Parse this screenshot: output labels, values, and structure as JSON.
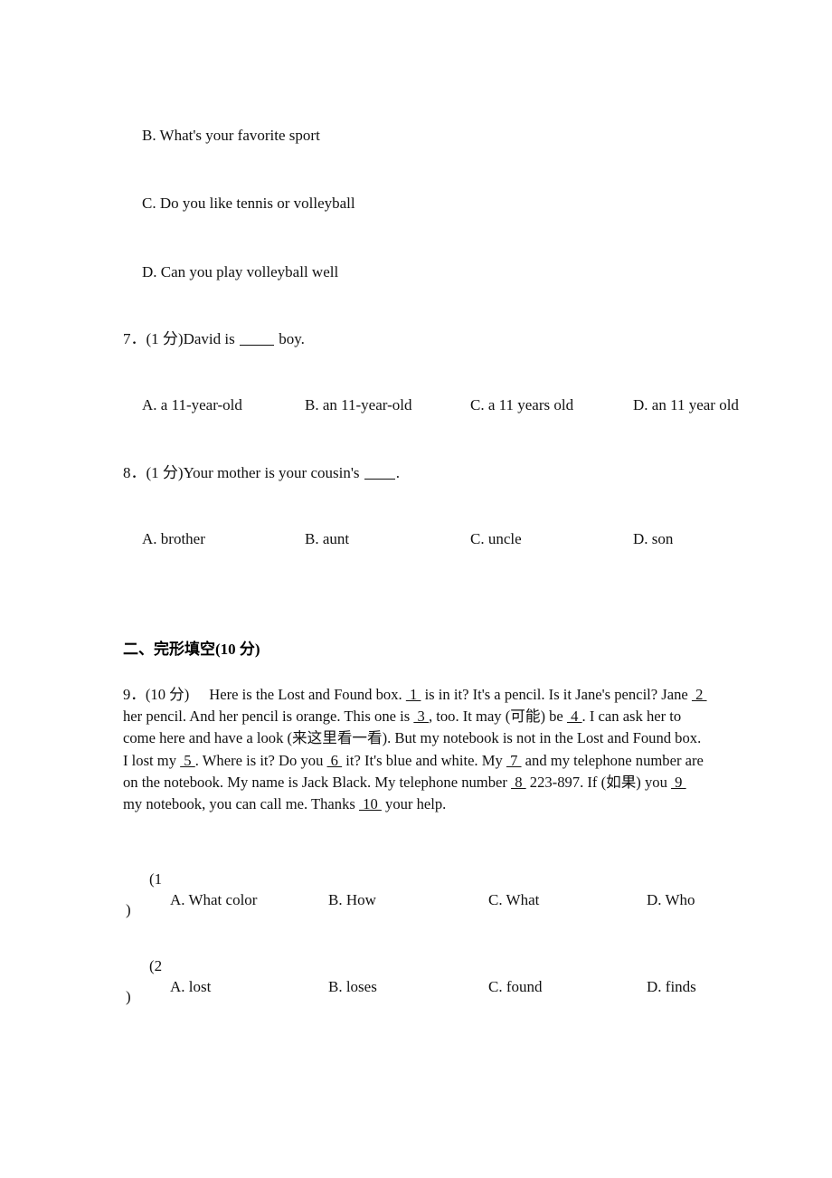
{
  "document": {
    "type": "english-exam-worksheet",
    "page_background": "#ffffff",
    "text_color": "#111111"
  },
  "carryover_options": [
    {
      "label": "B. What's your favorite sport"
    },
    {
      "label": "C. Do you like tennis or volleyball"
    },
    {
      "label": "D. Can you play volleyball well"
    }
  ],
  "questions": [
    {
      "number": "7．",
      "marks": "(1 分)",
      "stem_before": "David is ",
      "stem_after": " boy.",
      "options": [
        "A. a 11-year-old",
        "B. an 11-year-old",
        "C. a 11 years old",
        "D. an 11 year old"
      ]
    },
    {
      "number": "8．",
      "marks": "(1 分)",
      "stem_before": "Your mother is your cousin's ",
      "stem_after": ".",
      "options": [
        "A. brother",
        "B. aunt",
        "C. uncle",
        "D. son"
      ]
    }
  ],
  "section_two": {
    "heading": "二、完形填空(10 分)",
    "cloze": {
      "number": "9．",
      "marks": "(10 分)",
      "passage_segments": [
        {
          "kind": "text",
          "value": "Here is the Lost and Found box. "
        },
        {
          "kind": "gap",
          "value": " 1 "
        },
        {
          "kind": "text",
          "value": " is in it? It's a pencil. Is it Jane's pencil? Jane "
        },
        {
          "kind": "gap",
          "value": " 2 "
        },
        {
          "kind": "text",
          "value": " her pencil. And her pencil is orange. This one is "
        },
        {
          "kind": "gap",
          "value": " 3 "
        },
        {
          "kind": "text",
          "value": ", too. It may (可能) be "
        },
        {
          "kind": "gap",
          "value": " 4 "
        },
        {
          "kind": "text",
          "value": ". I can ask her to come here and have a look (来这里看一看). But my notebook is not in the Lost and Found box. I lost my "
        },
        {
          "kind": "gap",
          "value": " 5 "
        },
        {
          "kind": "text",
          "value": ". Where is it? Do you "
        },
        {
          "kind": "gap",
          "value": " 6 "
        },
        {
          "kind": "text",
          "value": " it? It's blue and white. My "
        },
        {
          "kind": "gap",
          "value": " 7 "
        },
        {
          "kind": "text",
          "value": " and my telephone number are on the notebook. My name is Jack Black. My telephone number "
        },
        {
          "kind": "gap",
          "value": " 8 "
        },
        {
          "kind": "text",
          "value": " 223-897. If (如果) you "
        },
        {
          "kind": "gap",
          "value": " 9 "
        },
        {
          "kind": "text",
          "value": " my notebook, you can call me. Thanks "
        },
        {
          "kind": "gap",
          "value": " 10 "
        },
        {
          "kind": "text",
          "value": " your help."
        }
      ],
      "sub_questions": [
        {
          "marker_open": "(1",
          "marker_close": ")",
          "options": [
            "A. What color",
            "B. How",
            "C. What",
            "D. Who"
          ]
        },
        {
          "marker_open": "(2",
          "marker_close": ")",
          "options": [
            "A. lost",
            "B. loses",
            "C. found",
            "D. finds"
          ]
        }
      ]
    }
  }
}
